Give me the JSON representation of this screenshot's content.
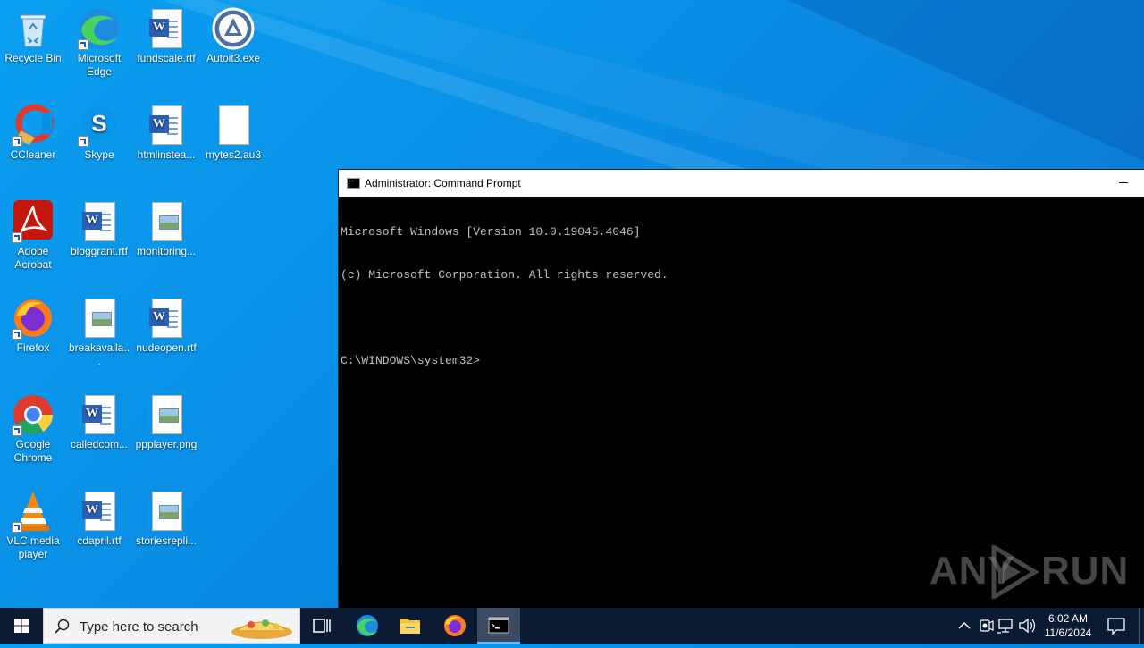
{
  "desktop": {
    "icons": [
      {
        "label": "Recycle Bin",
        "icon": "recycle-bin-icon"
      },
      {
        "label": "Microsoft Edge",
        "icon": "edge-icon"
      },
      {
        "label": "fundscale.rtf",
        "icon": "word-document-icon"
      },
      {
        "label": "Autoit3.exe",
        "icon": "autoit-icon"
      },
      {
        "label": "CCleaner",
        "icon": "ccleaner-icon"
      },
      {
        "label": "Skype",
        "icon": "skype-icon"
      },
      {
        "label": "htmlinstea...",
        "icon": "word-document-icon"
      },
      {
        "label": "mytes2.au3",
        "icon": "blank-file-icon"
      },
      {
        "label": "Adobe Acrobat",
        "icon": "acrobat-icon"
      },
      {
        "label": "bloggrant.rtf",
        "icon": "word-document-icon"
      },
      {
        "label": "monitoring...",
        "icon": "image-file-icon"
      },
      {
        "label": "Firefox",
        "icon": "firefox-icon"
      },
      {
        "label": "breakavaila...",
        "icon": "image-file-icon"
      },
      {
        "label": "nudeopen.rtf",
        "icon": "word-document-icon"
      },
      {
        "label": "Google Chrome",
        "icon": "chrome-icon"
      },
      {
        "label": "calledcom...",
        "icon": "word-document-icon"
      },
      {
        "label": "ppplayer.png",
        "icon": "image-file-icon"
      },
      {
        "label": "VLC media player",
        "icon": "vlc-icon"
      },
      {
        "label": "cdapril.rtf",
        "icon": "word-document-icon"
      },
      {
        "label": "storiesrepli...",
        "icon": "image-file-icon"
      }
    ]
  },
  "cmd_window": {
    "title": "Administrator: Command Prompt",
    "lines": [
      "Microsoft Windows [Version 10.0.19045.4046]",
      "(c) Microsoft Corporation. All rights reserved.",
      "",
      "C:\\WINDOWS\\system32>"
    ]
  },
  "watermark": {
    "left": "ANY",
    "right": "RUN"
  },
  "taskbar": {
    "search_placeholder": "Type here to search",
    "apps": [
      "task-view-icon",
      "edge-icon",
      "file-explorer-icon",
      "firefox-icon",
      "cmd-icon"
    ],
    "active_app": "cmd-icon",
    "clock_time": "6:02 AM",
    "clock_date": "11/6/2024"
  },
  "colors": {
    "desktop_blue": "#0a8fe6",
    "taskbar": "#0b1b33",
    "accent": "#77b7f4"
  }
}
